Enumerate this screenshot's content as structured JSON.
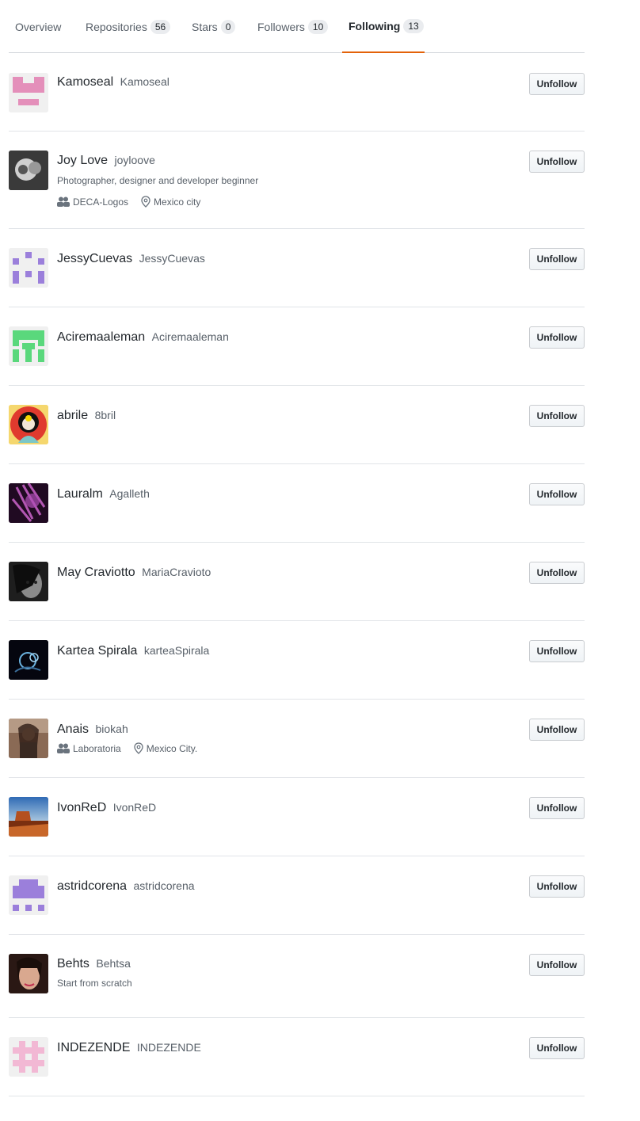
{
  "tabs": [
    {
      "label": "Overview",
      "count": null
    },
    {
      "label": "Repositories",
      "count": "56"
    },
    {
      "label": "Stars",
      "count": "0"
    },
    {
      "label": "Followers",
      "count": "10"
    },
    {
      "label": "Following",
      "count": "13"
    }
  ],
  "button_label": "Unfollow",
  "users": [
    {
      "name": "Kamoseal",
      "login": "Kamoseal"
    },
    {
      "name": "Joy Love",
      "login": "joyloove",
      "bio": "Photographer, designer and developer beginner",
      "org": "DECA-Logos",
      "location": "Mexico city"
    },
    {
      "name": "JessyCuevas",
      "login": "JessyCuevas"
    },
    {
      "name": "Aciremaaleman",
      "login": "Aciremaaleman"
    },
    {
      "name": "abrile",
      "login": "8bril"
    },
    {
      "name": "Lauralm",
      "login": "Agalleth"
    },
    {
      "name": "May Craviotto",
      "login": "MariaCravioto"
    },
    {
      "name": "Kartea Spirala",
      "login": "karteaSpirala"
    },
    {
      "name": "Anais",
      "login": "biokah",
      "org": "Laboratoria",
      "location": "Mexico City."
    },
    {
      "name": "IvonReD",
      "login": "IvonReD"
    },
    {
      "name": "astridcorena",
      "login": "astridcorena"
    },
    {
      "name": "Behts",
      "login": "Behtsa",
      "bio": "Start from scratch"
    },
    {
      "name": "INDEZENDE",
      "login": "INDEZENDE"
    }
  ],
  "colors": {
    "accent": "#e36209",
    "identicon_pink": "#e48fba",
    "identicon_purple": "#9b7fdb",
    "identicon_green": "#5ad87c"
  }
}
